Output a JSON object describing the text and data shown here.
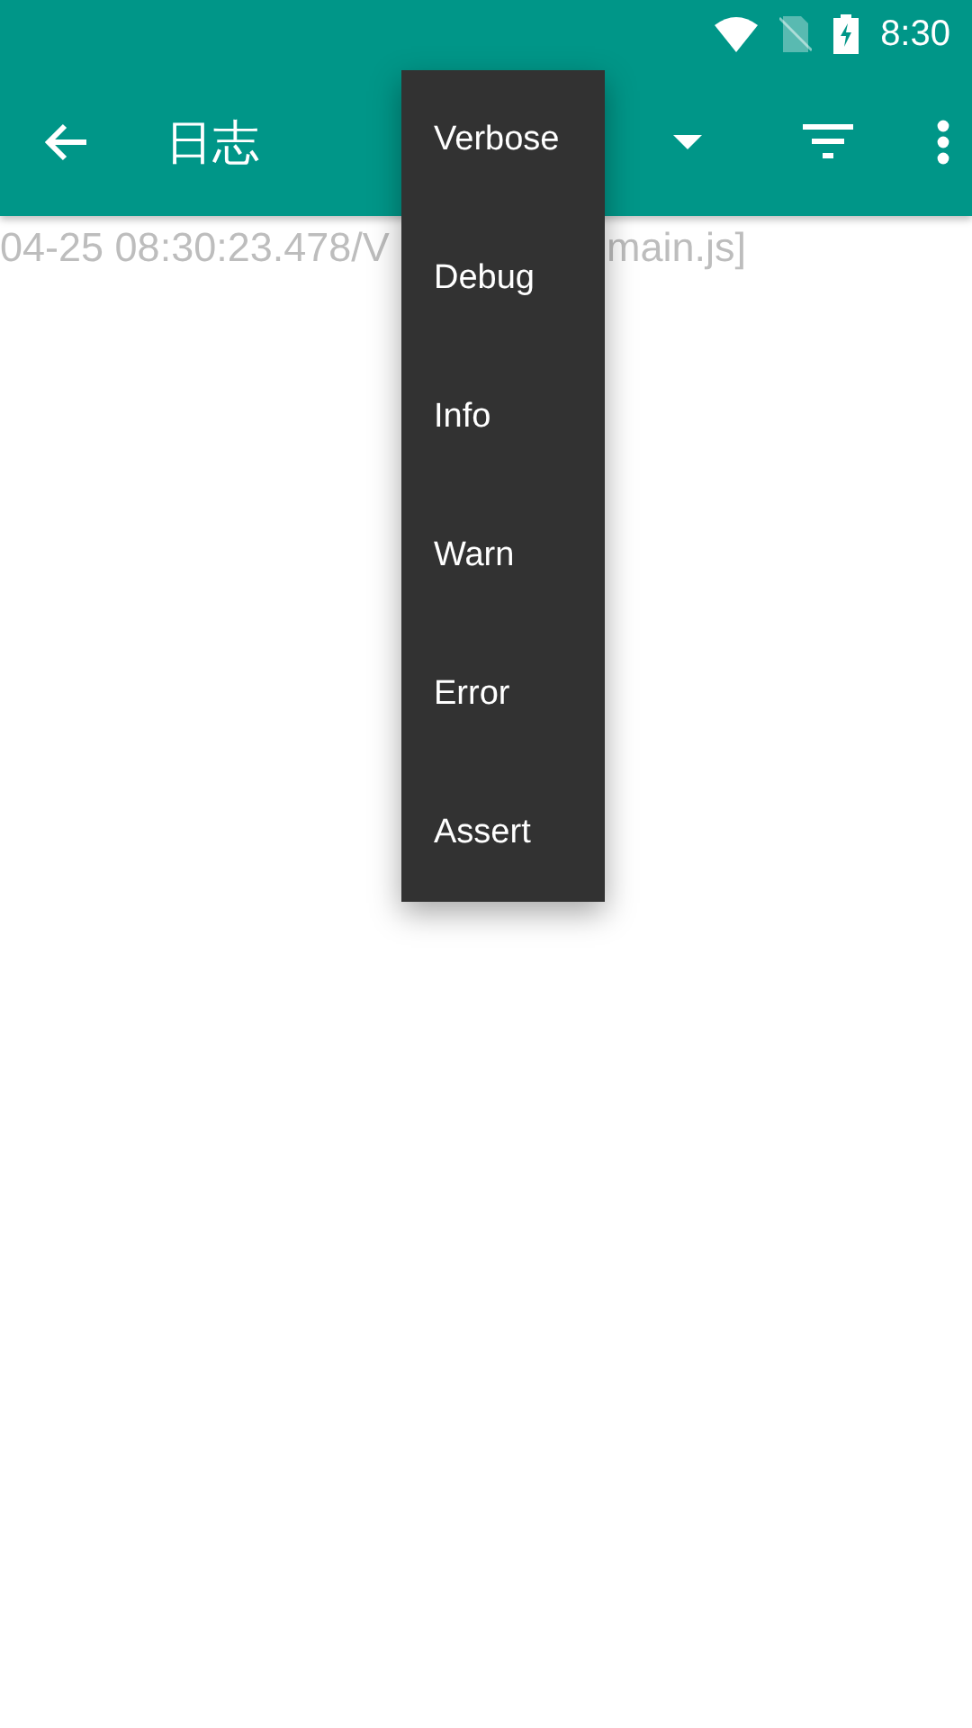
{
  "status_bar": {
    "time": "8:30"
  },
  "toolbar": {
    "title": "日志"
  },
  "log_lines": [
    {
      "start": "04-25 08:30:23.478/V",
      "end": "main.js]"
    }
  ],
  "level_menu": {
    "items": [
      "Verbose",
      "Debug",
      "Info",
      "Warn",
      "Error",
      "Assert"
    ]
  }
}
